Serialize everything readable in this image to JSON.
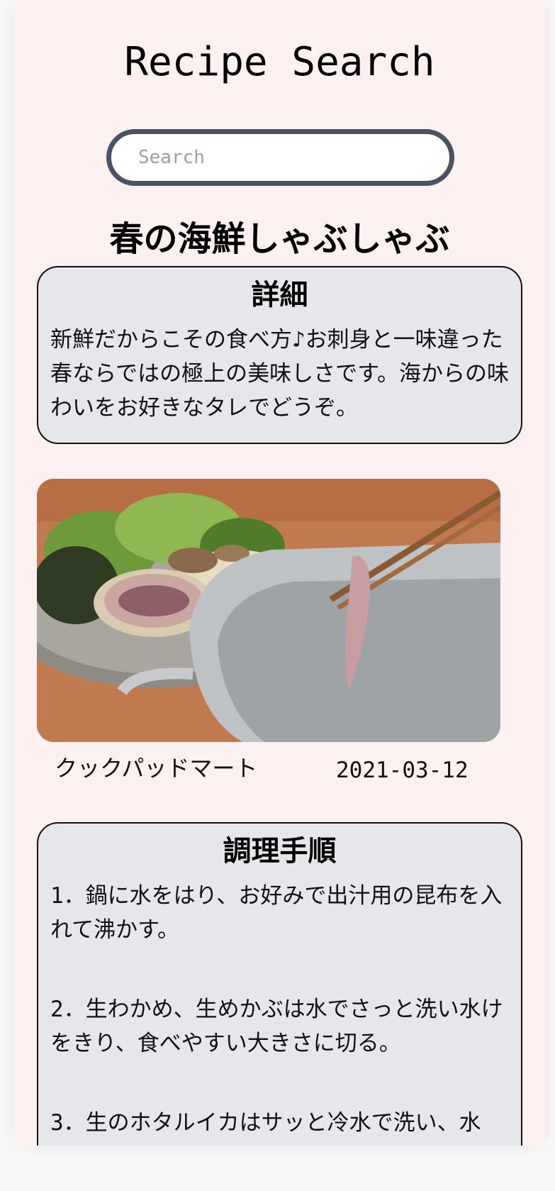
{
  "header": {
    "title": "Recipe Search"
  },
  "search": {
    "placeholder": "Search",
    "value": ""
  },
  "recipe": {
    "title": "春の海鮮しゃぶしゃぶ",
    "details_heading": "詳細",
    "description": "新鮮だからこその食べ方♪お刺身と一味違った春ならではの極上の美味しさです。海からの味わいをお好きなタレでどうぞ。",
    "source": "クックパッドマート",
    "date": "2021-03-12",
    "steps_heading": "調理手順",
    "steps": [
      "1．鍋に水をはり、お好みで出汁用の昆布を入れて沸かす。",
      "2．生わかめ、生めかぶは水でさっと洗い水けをきり、食べやすい大きさに切る。",
      "3．生のホタルイカはサッと冷水で洗い、水"
    ]
  },
  "colors": {
    "page_background": "#fdf0f0",
    "card_background": "#e5e7eb",
    "search_border": "#4a5363"
  }
}
